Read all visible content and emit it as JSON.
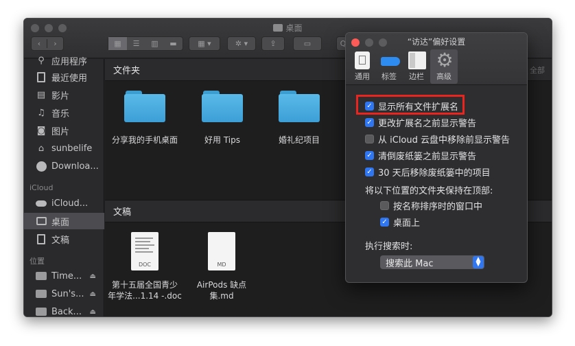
{
  "window": {
    "title": "桌面",
    "toolbar_search_partial": "Q"
  },
  "sidebar": {
    "items_top": [
      {
        "label": "应用程序",
        "icon": "applications-icon"
      },
      {
        "label": "最近使用",
        "icon": "recents-icon"
      },
      {
        "label": "影片",
        "icon": "movies-icon"
      },
      {
        "label": "音乐",
        "icon": "music-icon"
      },
      {
        "label": "图片",
        "icon": "pictures-icon"
      },
      {
        "label": "sunbelife",
        "icon": "home-icon"
      },
      {
        "label": "Downloa...",
        "icon": "downloads-icon"
      }
    ],
    "icloud_head": "iCloud",
    "icloud_items": [
      {
        "label": "iCloud...",
        "icon": "icloud-drive-icon"
      },
      {
        "label": "桌面",
        "icon": "desktop-icon"
      },
      {
        "label": "文稿",
        "icon": "documents-icon"
      }
    ],
    "locations_head": "位置",
    "location_items": [
      {
        "label": "Time...",
        "icon": "disk-icon"
      },
      {
        "label": "Sun's...",
        "icon": "disk-icon"
      },
      {
        "label": "Back...",
        "icon": "disk-icon"
      }
    ],
    "eject_glyph": "⏏"
  },
  "content": {
    "section1": {
      "title": "文件夹",
      "right": "全部"
    },
    "folders": [
      {
        "label": "分享我的手机桌面"
      },
      {
        "label": "好用 Tips"
      },
      {
        "label": "婚礼纪项目"
      }
    ],
    "section2": {
      "title": "文稿"
    },
    "docs": [
      {
        "ext": "DOC",
        "label1": "第十五届全国青少",
        "label2": "年学法...1.14 -.doc"
      },
      {
        "ext": "MD",
        "label1": "AirPods 缺点",
        "label2": "集.md"
      }
    ]
  },
  "prefs": {
    "title": "“访达”偏好设置",
    "tabs": [
      {
        "label": "通用",
        "icon": "general-icon"
      },
      {
        "label": "标签",
        "icon": "tags-icon"
      },
      {
        "label": "边栏",
        "icon": "sidebar-icon"
      },
      {
        "label": "高级",
        "icon": "gear-icon"
      }
    ],
    "options": [
      {
        "label": "显示所有文件扩展名",
        "checked": true
      },
      {
        "label": "更改扩展名之前显示警告",
        "checked": true
      },
      {
        "label": "从 iCloud 云盘中移除前显示警告",
        "checked": false
      },
      {
        "label": "清倒废纸篓之前显示警告",
        "checked": true
      },
      {
        "label": "30 天后移除废纸篓中的项目",
        "checked": true
      }
    ],
    "keep_folders_label": "将以下位置的文件夹保持在顶部:",
    "keep_options": [
      {
        "label": "按名称排序时的窗口中",
        "checked": false
      },
      {
        "label": "桌面上",
        "checked": true
      }
    ],
    "search_label": "执行搜索时:",
    "search_popup_value": "搜索此 Mac",
    "highlight_color": "#e8261f",
    "accent_color": "#2f76f0"
  }
}
